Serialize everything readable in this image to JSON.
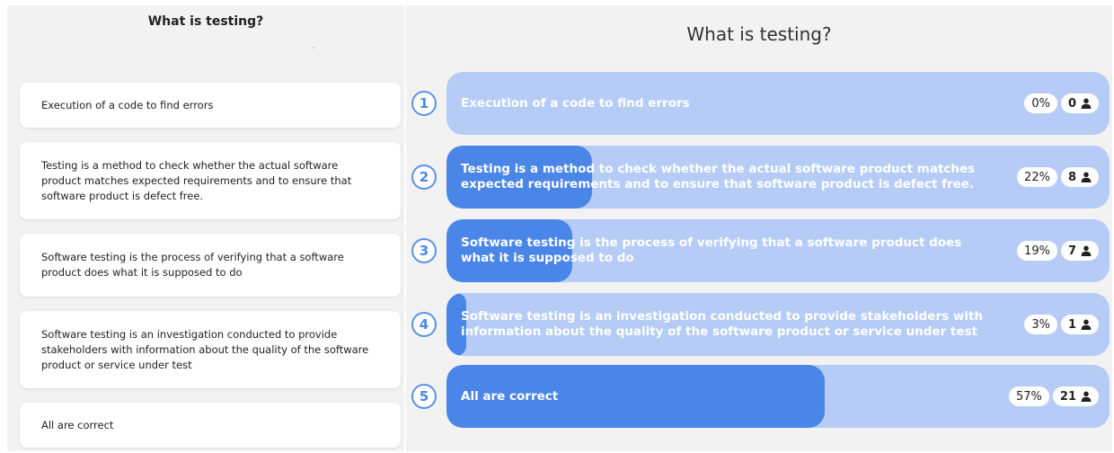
{
  "left": {
    "title": "What is testing?",
    "cards": [
      "Execution of a code to find errors",
      "Testing is a method to check whether the actual software product matches expected requirements and to ensure that software product is defect free.",
      "Software testing is the process of verifying that a software product does what it is supposed to do",
      "Software testing is an investigation conducted to provide stakeholders with information about the quality of the software product or service under test",
      "All are correct"
    ]
  },
  "right": {
    "title": "What is testing?",
    "options": [
      {
        "number": "1",
        "text": "Execution of a code to find errors",
        "percent": "0%",
        "count": "0",
        "fill": 0.0
      },
      {
        "number": "2",
        "text": "Testing is a method to check whether the actual software product matches expected requirements and to ensure that software product is defect free.",
        "percent": "22%",
        "count": "8",
        "fill": 0.22
      },
      {
        "number": "3",
        "text": "Software testing is the process of verifying that a software product does what it is supposed to do",
        "percent": "19%",
        "count": "7",
        "fill": 0.19
      },
      {
        "number": "4",
        "text": "Software testing is an investigation conducted to provide stakeholders with information about the quality of the software product or service under test",
        "percent": "3%",
        "count": "1",
        "fill": 0.03
      },
      {
        "number": "5",
        "text": "All are correct",
        "percent": "57%",
        "count": "21",
        "fill": 0.57
      }
    ]
  },
  "colors": {
    "accent": "#4a86e8",
    "bar_background": "#b6ccf6",
    "panel_background": "#f2f2f2"
  },
  "icons": {
    "count": "user-icon"
  }
}
